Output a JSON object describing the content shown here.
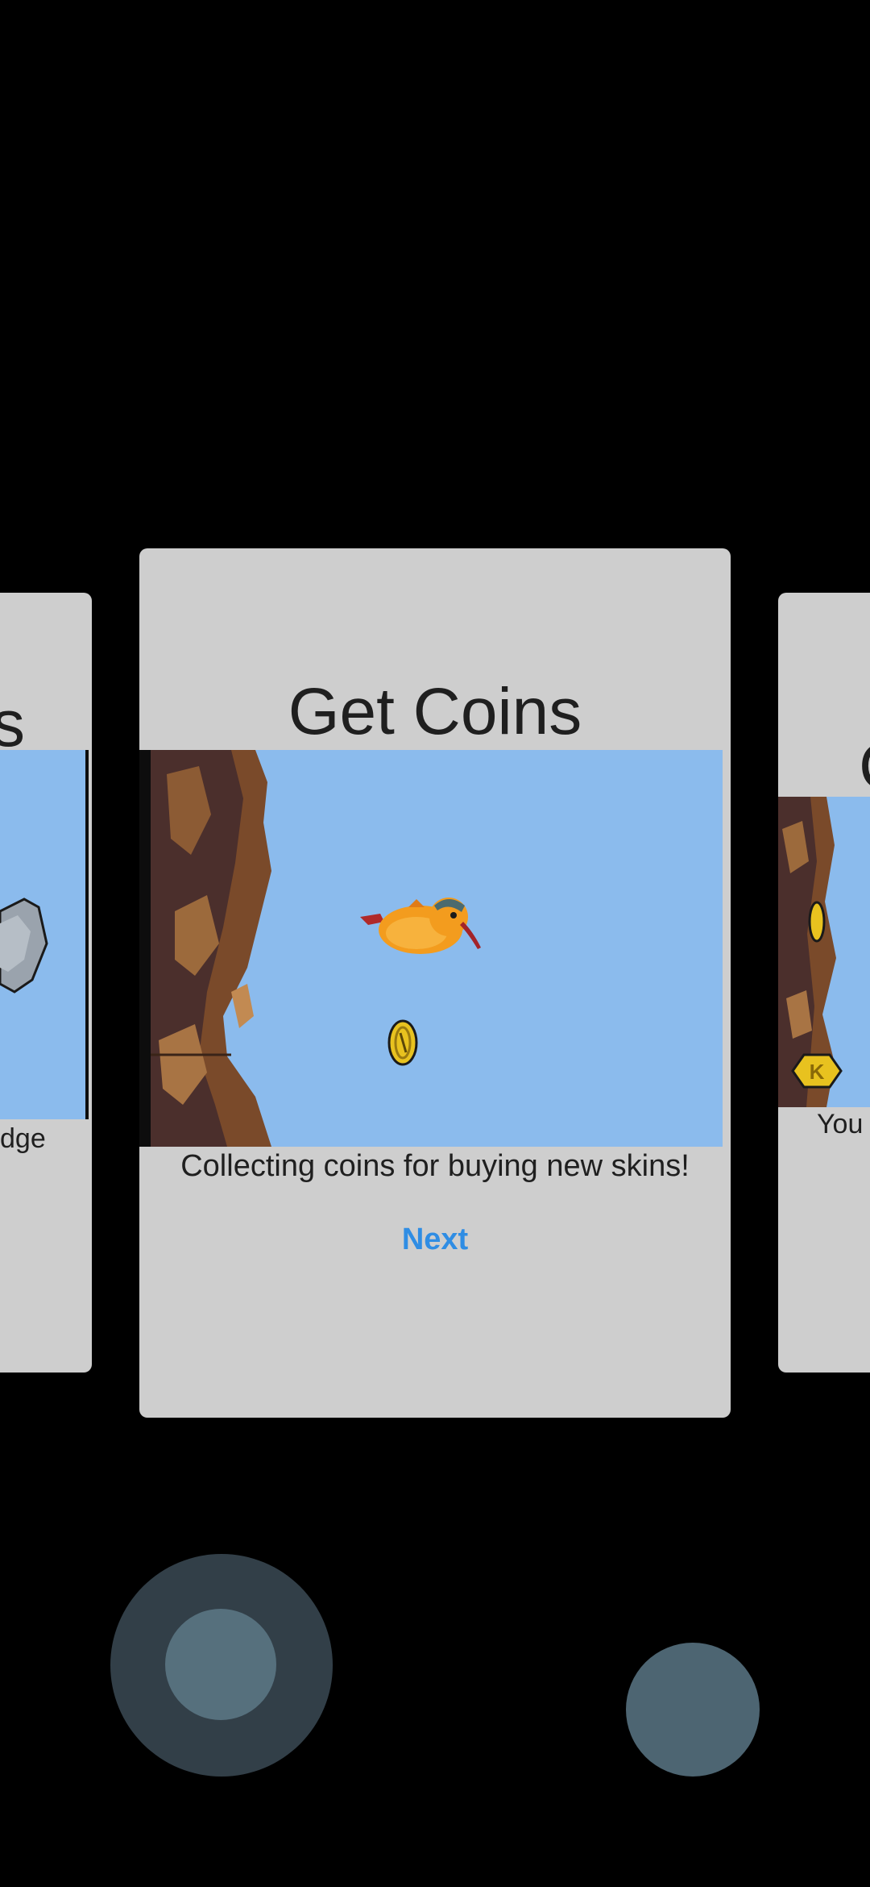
{
  "carousel": {
    "left_card": {
      "title_fragment": "s",
      "desc_fragment": "dge"
    },
    "main_card": {
      "title": "Get Coins",
      "description": "Collecting coins for buying new skins!",
      "next_label": "Next"
    },
    "right_card": {
      "title_fragment": "C",
      "desc_fragment": "You"
    }
  },
  "colors": {
    "card_bg": "#cecece",
    "sky": "#8bbbed",
    "accent": "#2f8de4",
    "background": "#000000"
  },
  "icons": {
    "coin": "k-coin-icon",
    "player": "bird-sprite",
    "obstacle": "rock-sprite"
  },
  "controls": {
    "joystick": "joystick",
    "action": "action-button"
  }
}
